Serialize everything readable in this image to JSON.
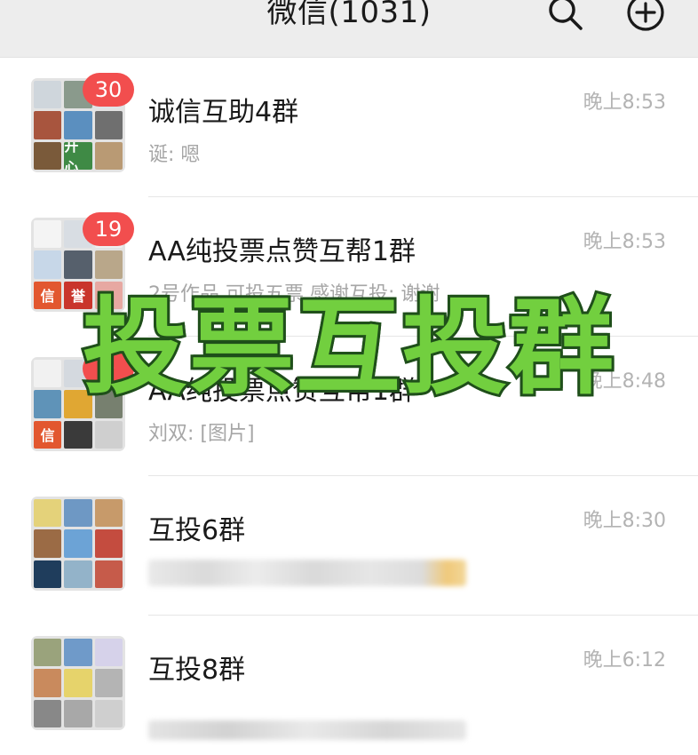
{
  "header": {
    "title": "微信(1031)",
    "search_icon": "search-icon",
    "add_icon": "plus-circle-icon"
  },
  "chats": [
    {
      "name": "诚信互助4群",
      "time": "晚上8:53",
      "preview": "诞: 嗯",
      "unread": "30",
      "avatar_tiles": [
        {
          "color": "#cfd6dc",
          "text": ""
        },
        {
          "color": "#8a9a8c",
          "text": ""
        },
        {
          "color": "#e0e4e8",
          "text": ""
        },
        {
          "color": "#a8553e",
          "text": ""
        },
        {
          "color": "#5b8fbf",
          "text": ""
        },
        {
          "color": "#6f6f6f",
          "text": ""
        },
        {
          "color": "#7a5a3a",
          "text": ""
        },
        {
          "color": "#3f8a45",
          "text": "开心"
        },
        {
          "color": "#b99a74",
          "text": ""
        }
      ]
    },
    {
      "name": "AA纯投票点赞互帮1群",
      "time": "晚上8:53",
      "preview": "2号作品 可投五票 感谢互投: 谢谢",
      "unread": "19",
      "avatar_tiles": [
        {
          "color": "#f4f4f4",
          "text": ""
        },
        {
          "color": "#d8dde3",
          "text": ""
        },
        {
          "color": "#efefef",
          "text": ""
        },
        {
          "color": "#c7d7e8",
          "text": ""
        },
        {
          "color": "#56606c",
          "text": ""
        },
        {
          "color": "#b9a78a",
          "text": ""
        },
        {
          "color": "#e2572f",
          "text": "信"
        },
        {
          "color": "#c9352c",
          "text": "誉"
        },
        {
          "color": "#e7a8a2",
          "text": ""
        }
      ]
    },
    {
      "name": "AA纯投票点赞互帮1群",
      "time": "晚上8:48",
      "preview": "刘双: [图片]",
      "unread": "0",
      "avatar_tiles": [
        {
          "color": "#f1f1f1",
          "text": ""
        },
        {
          "color": "#d4d9df",
          "text": ""
        },
        {
          "color": "#eeeeee",
          "text": ""
        },
        {
          "color": "#5f93b8",
          "text": ""
        },
        {
          "color": "#e0a733",
          "text": ""
        },
        {
          "color": "#77806f",
          "text": ""
        },
        {
          "color": "#e2572f",
          "text": "信"
        },
        {
          "color": "#3a3a3a",
          "text": ""
        },
        {
          "color": "#cfcfcf",
          "text": ""
        }
      ]
    },
    {
      "name": "互投6群",
      "time": "晚上8:30",
      "preview": "",
      "unread": "",
      "avatar_tiles": [
        {
          "color": "#e4d27a",
          "text": ""
        },
        {
          "color": "#6e98c4",
          "text": ""
        },
        {
          "color": "#c79a6a",
          "text": ""
        },
        {
          "color": "#9b6b45",
          "text": ""
        },
        {
          "color": "#6ca3d6",
          "text": ""
        },
        {
          "color": "#c44c3f",
          "text": ""
        },
        {
          "color": "#1f3d5c",
          "text": ""
        },
        {
          "color": "#93b3c9",
          "text": ""
        },
        {
          "color": "#c65b4a",
          "text": ""
        }
      ]
    },
    {
      "name": "互投8群",
      "time": "晚上6:12",
      "preview": "",
      "unread": "",
      "avatar_tiles": [
        {
          "color": "#9aa37c",
          "text": ""
        },
        {
          "color": "#6f9ac9",
          "text": ""
        },
        {
          "color": "#d6d2ea",
          "text": ""
        },
        {
          "color": "#c98a5d",
          "text": ""
        },
        {
          "color": "#e6d36b",
          "text": ""
        },
        {
          "color": "#b4b4b4",
          "text": ""
        },
        {
          "color": "#888888",
          "text": ""
        },
        {
          "color": "#a8a8a8",
          "text": ""
        },
        {
          "color": "#cfcfcf",
          "text": ""
        }
      ]
    }
  ],
  "overlay": {
    "text": "投票互投群",
    "fill_color": "#72cf3f",
    "stroke_color": "#1f4f1a"
  }
}
